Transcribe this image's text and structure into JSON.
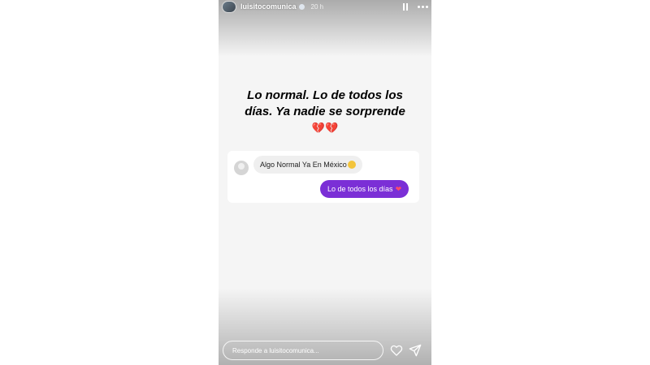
{
  "story": {
    "username": "luisitocomunica",
    "time": "20 h",
    "headline": "Lo normal. Lo de todos los días. Ya nadie se sorprende",
    "headline_emoji": "💔💔"
  },
  "chat": {
    "incoming": "Algo Normal Ya En México",
    "outgoing": "Lo de todos los días",
    "outgoing_emoji": "❤"
  },
  "reply": {
    "placeholder": "Responde a luisitocomunica..."
  },
  "icons": {
    "header": [
      "pause-icon",
      "more-icon",
      "verified-badge-icon"
    ],
    "footer": [
      "heart-icon",
      "send-icon"
    ]
  },
  "colors": {
    "outgoing_bubble": "#7b2fd6",
    "incoming_bubble": "#efefef",
    "story_background": "#f5f5f5"
  }
}
